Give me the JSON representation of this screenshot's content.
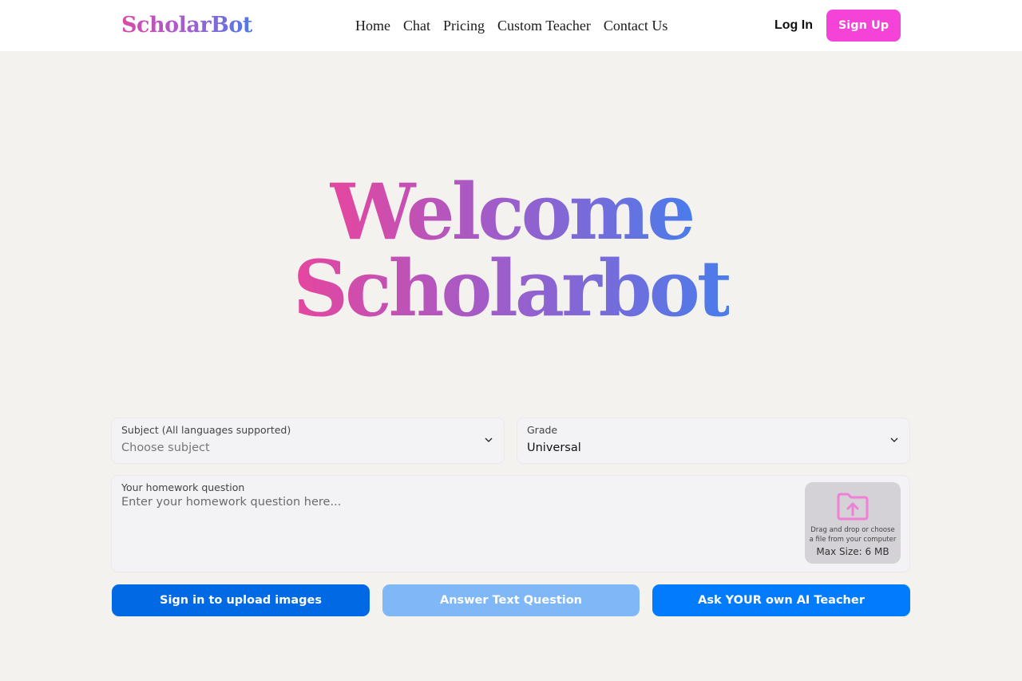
{
  "nav": {
    "logo": "ScholarBot",
    "links": [
      "Home",
      "Chat",
      "Pricing",
      "Custom Teacher",
      "Contact Us"
    ],
    "login": "Log In",
    "signup": "Sign Up"
  },
  "hero": {
    "line1": "Welcome",
    "line2": "Scholarbot"
  },
  "form": {
    "subject_label": "Subject (All languages supported)",
    "subject_value": "Choose subject",
    "grade_label": "Grade",
    "grade_value": "Universal",
    "question_label": "Your homework question",
    "question_placeholder": "Enter your homework question here...",
    "upload_text": "Drag and drop or choose a file from your computer",
    "upload_size": "Max Size: 6 MB"
  },
  "actions": {
    "upload_images": "Sign in to upload images",
    "answer_text": "Answer Text Question",
    "ask_teacher": "Ask YOUR own AI Teacher"
  },
  "colors": {
    "accent_pink": "#f542d7",
    "blue_primary": "#0269e4",
    "blue_disabled": "#80b8f7",
    "blue_bright": "#027bfc"
  }
}
